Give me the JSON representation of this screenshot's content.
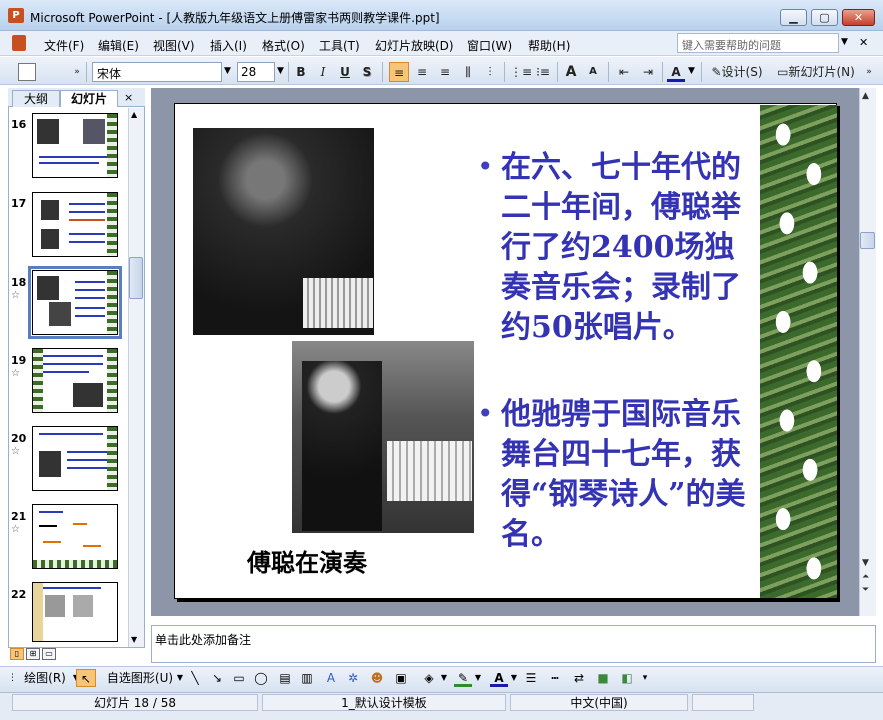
{
  "window": {
    "title": "Microsoft PowerPoint - [人教版九年级语文上册傅雷家书两则教学课件.ppt]",
    "app_icon": "P",
    "controls": {
      "minimize": "▁",
      "restore": "▢",
      "close": "✕"
    }
  },
  "menu": {
    "items": [
      "文件(F)",
      "编辑(E)",
      "视图(V)",
      "插入(I)",
      "格式(O)",
      "工具(T)",
      "幻灯片放映(D)",
      "窗口(W)",
      "帮助(H)"
    ],
    "help_placeholder": "键入需要帮助的问题"
  },
  "toolbar": {
    "font_name": "宋体",
    "font_size": "28",
    "bold": "B",
    "italic": "I",
    "underline": "U",
    "shadow": "S",
    "font_color_label": "A",
    "grow_font": "A",
    "shrink_font": "A",
    "design_label": "设计(S)",
    "new_slide_label": "新幻灯片(N)"
  },
  "left_panel": {
    "tabs": [
      "大纲",
      "幻灯片"
    ],
    "close": "×",
    "thumbnails": [
      {
        "number": "16",
        "star": ""
      },
      {
        "number": "17",
        "star": ""
      },
      {
        "number": "18",
        "star": "☆"
      },
      {
        "number": "19",
        "star": "☆"
      },
      {
        "number": "20",
        "star": "☆"
      },
      {
        "number": "21",
        "star": "☆"
      },
      {
        "number": "22",
        "star": ""
      }
    ]
  },
  "slide": {
    "bullets": [
      "在六、七十年代的二十年间，傅聪举行了约2400场独奏音乐会；录制了约50张唱片。",
      "他驰骋于国际音乐舞台四十七年，获得“钢琴诗人”的美名。"
    ],
    "bullet_marker": "•",
    "caption": "傅聪在演奏",
    "bullet_color": "#3333b3"
  },
  "notes": {
    "placeholder": "单击此处添加备注"
  },
  "drawing_toolbar": {
    "draw_label": "绘图(R)",
    "autoshapes_label": "自选图形(U)"
  },
  "status": {
    "slide_info": "幻灯片 18 / 58",
    "template": "1_默认设计模板",
    "language": "中文(中国)"
  }
}
